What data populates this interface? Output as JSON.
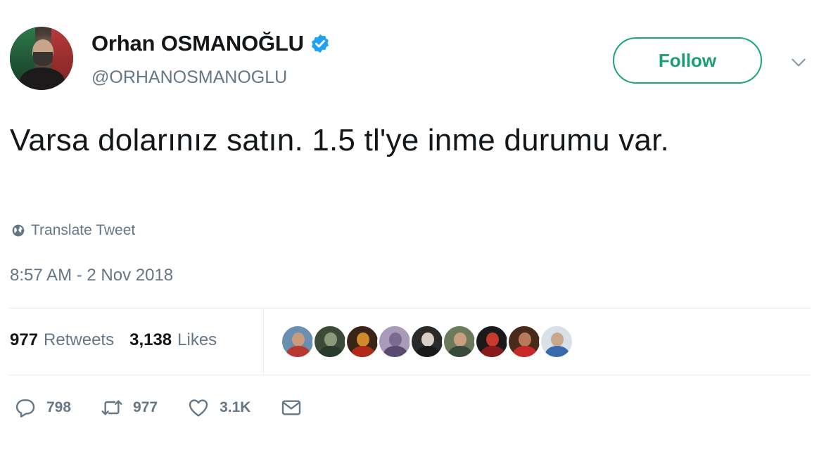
{
  "user": {
    "display_name": "Orhan OSMANOĞLU",
    "handle": "@ORHANOSMANOGLU",
    "verified": true,
    "avatar_icon": "profile-photo"
  },
  "follow_button": {
    "label": "Follow",
    "color": "#1da57a"
  },
  "menu_icon": "chevron-down-icon",
  "tweet": {
    "text": "Varsa dolarınız satın. 1.5 tl'ye inme durumu var.",
    "translate_label": "Translate Tweet",
    "timestamp": "8:57 AM - 2 Nov 2018"
  },
  "stats": {
    "retweets_count": "977",
    "retweets_label": "Retweets",
    "likes_count": "3,138",
    "likes_label": "Likes",
    "liker_avatars": 9
  },
  "actions": {
    "reply_count": "798",
    "retweet_count": "977",
    "like_count": "3.1K",
    "icons": [
      "reply-icon",
      "retweet-icon",
      "heart-icon",
      "envelope-icon"
    ]
  },
  "colors": {
    "accent": "#1da1f2",
    "follow_green": "#1da57a",
    "secondary_text": "#657786",
    "primary_text": "#14171a"
  }
}
